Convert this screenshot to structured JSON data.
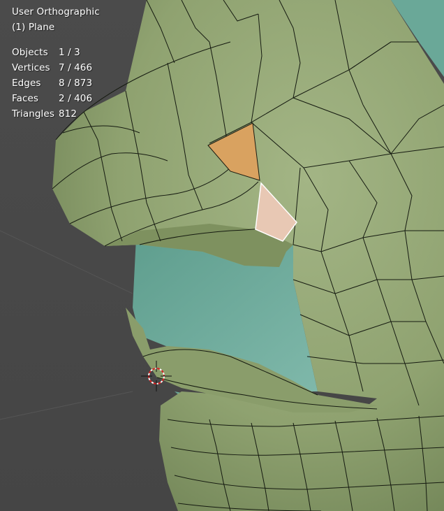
{
  "viewport": {
    "view_name": "User Orthographic",
    "active_object": "(1) Plane"
  },
  "stats": [
    {
      "label": "Objects",
      "value": "1 / 3"
    },
    {
      "label": "Vertices",
      "value": "7 / 466"
    },
    {
      "label": "Edges",
      "value": "8 / 873"
    },
    {
      "label": "Faces",
      "value": "2 / 406"
    },
    {
      "label": "Triangles",
      "value": "812"
    }
  ],
  "colors": {
    "background": "#4a4a4a",
    "mesh_face": "#8fa270",
    "mesh_edge": "#151a10",
    "underlying_surface": "#6aa898",
    "selected_face_orange": "#d9a260",
    "active_face_highlight": "#e8c8b4",
    "secondary_object": "#9a4c7a"
  },
  "icons": {
    "cursor": "3d-cursor-icon"
  }
}
